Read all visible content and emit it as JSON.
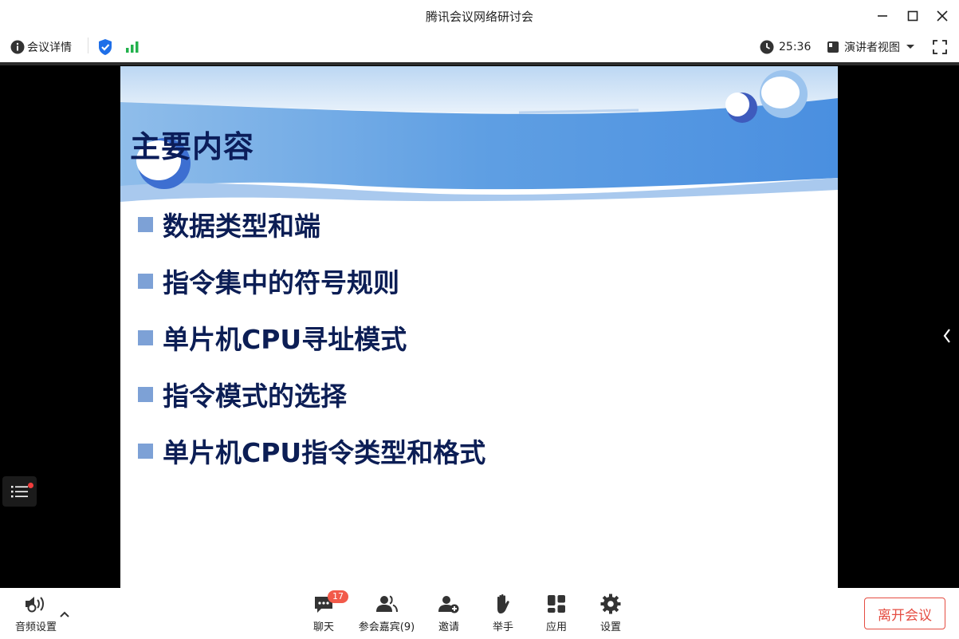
{
  "window": {
    "title": "腾讯会议网络研讨会"
  },
  "infobar": {
    "meeting_details": "会议详情",
    "timer": "25:36",
    "view_mode": "演讲者视图"
  },
  "slide": {
    "title": "主要内容",
    "bullets": [
      "数据类型和端",
      "指令集中的符号规则",
      "单片机CPU寻址模式",
      "指令模式的选择",
      "单片机CPU指令类型和格式"
    ]
  },
  "toolbar": {
    "audio_settings": "音频设置",
    "chat": "聊天",
    "chat_badge": "17",
    "participants": "参会嘉宾(9)",
    "invite": "邀请",
    "raise_hand": "举手",
    "apps": "应用",
    "settings": "设置",
    "leave": "离开会议"
  },
  "colors": {
    "leave_red": "#e54d42",
    "shield_blue": "#1f6fe8",
    "signal_green": "#22b14c",
    "slide_title_navy": "#0b1d5a",
    "bullet_square": "#7da1d6"
  }
}
